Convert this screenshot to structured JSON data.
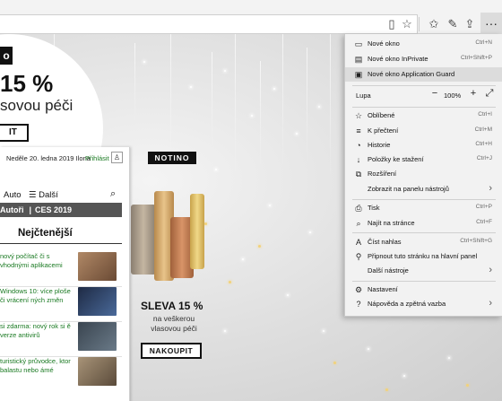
{
  "browser": {
    "toolbar_icons": [
      "reading-view-icon",
      "favorite-star-icon",
      "favorites-hub-icon",
      "pen-icon",
      "share-icon",
      "more-icon"
    ]
  },
  "page": {
    "hero": {
      "tag": "o",
      "discount": "15 %",
      "text": "sovou péči",
      "button": "IT"
    },
    "sidebar": {
      "date": "Neděle 20. ledna 2019 Ilona",
      "login": "Přihlásit",
      "nav_auto": "Auto",
      "nav_more": "Další",
      "bar_items": [
        "Autoři",
        "CES 2019"
      ],
      "section_title": "Nejčtenější",
      "articles": [
        {
          "text": "nový počítač či s vhodnými aplikacemi",
          "thumb": "#8a6a4a"
        },
        {
          "text": "Windows 10: více ploše či vrácení ných změn",
          "thumb": "#2b3a5a"
        },
        {
          "text": "si zdarma: nový rok si ě verze antivirů",
          "thumb": "#4a5560"
        },
        {
          "text": "turistický průvodce, ktor balastu nebo ámé",
          "thumb": "#7a6a58"
        }
      ]
    },
    "ad": {
      "brand": "NOTINO",
      "headline": "SLEVA 15 %",
      "subline": "na veškerou vlasovou péči",
      "cta": "NAKOUPIT"
    }
  },
  "menu": {
    "items": [
      {
        "icon": "new-window-icon",
        "glyph": "▭",
        "label": "Nové okno",
        "shortcut": "Ctrl+N"
      },
      {
        "icon": "inprivate-icon",
        "glyph": "▤",
        "label": "Nové okno InPrivate",
        "shortcut": "Ctrl+Shift+P"
      },
      {
        "icon": "application-guard-icon",
        "glyph": "▣",
        "label": "Nové okno Application Guard",
        "shortcut": ""
      }
    ],
    "zoom": {
      "label": "Lupa",
      "minus": "−",
      "value": "100%",
      "plus": "+",
      "fullscreen": "⤢"
    },
    "items2": [
      {
        "icon": "favorites-icon",
        "glyph": "☆",
        "label": "Oblíbené",
        "shortcut": "Ctrl+I"
      },
      {
        "icon": "reading-list-icon",
        "glyph": "≡",
        "label": "K přečtení",
        "shortcut": "Ctrl+M"
      },
      {
        "icon": "history-icon",
        "glyph": "◔",
        "label": "Historie",
        "shortcut": "Ctrl+H"
      },
      {
        "icon": "downloads-icon",
        "glyph": "↓",
        "label": "Položky ke stažení",
        "shortcut": "Ctrl+J"
      },
      {
        "icon": "extensions-icon",
        "glyph": "⧉",
        "label": "Rozšíření",
        "shortcut": ""
      },
      {
        "icon": "",
        "glyph": "",
        "label": "Zobrazit na panelu nástrojů",
        "shortcut": "",
        "arrow": "›"
      }
    ],
    "items3": [
      {
        "icon": "print-icon",
        "glyph": "⎙",
        "label": "Tisk",
        "shortcut": "Ctrl+P"
      },
      {
        "icon": "find-icon",
        "glyph": "⌕",
        "label": "Najít na stránce",
        "shortcut": "Ctrl+F"
      }
    ],
    "items4": [
      {
        "icon": "read-aloud-icon",
        "glyph": "A",
        "label": "Číst nahlas",
        "shortcut": "Ctrl+Shift+G"
      },
      {
        "icon": "pin-icon",
        "glyph": "⚲",
        "label": "Připnout tuto stránku na hlavní panel",
        "shortcut": ""
      },
      {
        "icon": "",
        "glyph": "",
        "label": "Další nástroje",
        "shortcut": "",
        "arrow": "›"
      }
    ],
    "items5": [
      {
        "icon": "settings-icon",
        "glyph": "⚙",
        "label": "Nastavení",
        "shortcut": ""
      },
      {
        "icon": "help-icon",
        "glyph": "?",
        "label": "Nápověda a zpětná vazba",
        "shortcut": "",
        "arrow": "›"
      }
    ]
  }
}
